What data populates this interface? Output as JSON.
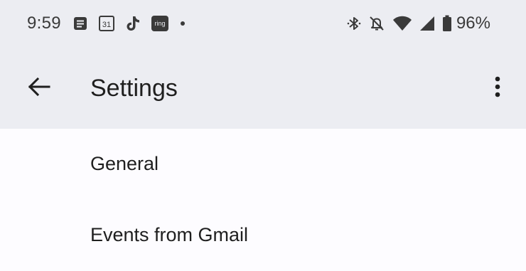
{
  "status_bar": {
    "time": "9:59",
    "battery_percent": "96%",
    "left_icons": [
      "notes-icon",
      "calendar-icon",
      "tiktok-icon",
      "ring-icon",
      "notification-dot-icon"
    ],
    "calendar_day": "31",
    "ring_text": "ring",
    "right_icons": [
      "bluetooth-icon",
      "notifications-off-icon",
      "wifi-icon",
      "cellular-signal-icon",
      "battery-icon"
    ]
  },
  "toolbar": {
    "back_icon": "arrow-back-icon",
    "title": "Settings",
    "more_icon": "more-vert-icon"
  },
  "settings_list": {
    "items": [
      {
        "label": "General"
      },
      {
        "label": "Events from Gmail"
      }
    ]
  },
  "colors": {
    "header_background": "#ecedf2",
    "list_background": "#fdfcff",
    "text_primary": "#1f1f1f",
    "status_text": "#3a3a3a"
  }
}
